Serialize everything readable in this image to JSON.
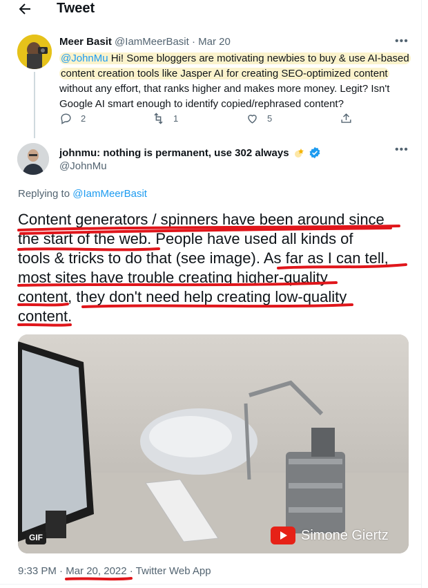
{
  "header": {
    "title": "Tweet",
    "back_icon": "arrow-left-icon"
  },
  "quoted_tweet": {
    "author_name": "Meer Basit",
    "author_handle": "@IamMeerBasit",
    "separator": "·",
    "date": "Mar 20",
    "mention": "@JohnMu",
    "lines": [
      " Hi! Some bloggers are motivating newbies to buy & use AI-based",
      "content creation tools like Jasper AI for creating SEO-optimized content",
      "without any effort, that ranks higher and makes more money. Legit? Isn't",
      "Google AI smart enough to identify copied/rephrased content?"
    ],
    "replies": "2",
    "retweets": "1",
    "likes": "5"
  },
  "main_tweet": {
    "author_name": "johnmu: nothing is permanent, use 302 always",
    "author_handle": "@JohnMu",
    "replying_prefix": "Replying to ",
    "replying_handle": "@IamMeerBasit",
    "lines": [
      "Content generators / spinners have been around since",
      "the start of the web. People have used all kinds of",
      "tools & tricks to do that (see image). As far as I can tell,",
      "most sites have trouble creating higher-quality",
      "content, they don't need help creating low-quality",
      "content."
    ],
    "media_badge": "GIF",
    "watermark": "Simone Giertz"
  },
  "footer": {
    "time": "9:33 PM",
    "sep1": " · ",
    "date": "Mar 20, 2022",
    "sep2": " · ",
    "source": "Twitter Web App"
  },
  "colors": {
    "link": "#1d9bf0",
    "highlight": "#fbf3cc",
    "annotation": "#e0161b"
  }
}
